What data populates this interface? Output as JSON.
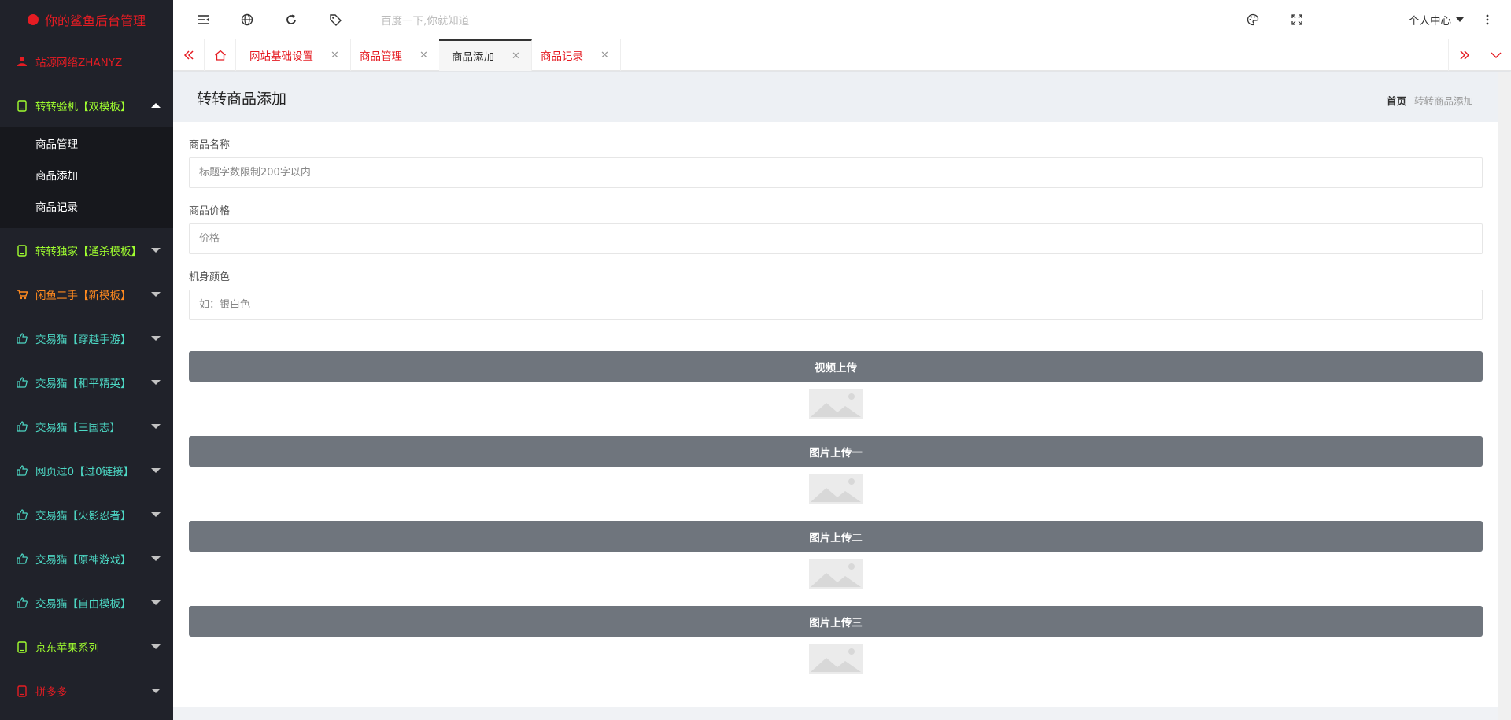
{
  "app": {
    "title": "你的鲨鱼后台管理",
    "colors": {
      "brand": "#e51c23",
      "sidebar_bg": "#20222a",
      "submenu_bg": "#17181d",
      "upload_btn": "#6f757d"
    }
  },
  "sidebar": {
    "items": [
      {
        "label": "站源网络ZHANYZ",
        "icon": "user-icon",
        "color": "#e51c23"
      },
      {
        "label": "转转验机【双模板】",
        "icon": "phone-icon",
        "color": "#a0ff2f",
        "expanded": true,
        "children": [
          {
            "label": "商品管理"
          },
          {
            "label": "商品添加"
          },
          {
            "label": "商品记录"
          }
        ]
      },
      {
        "label": "转转独家【通杀模板】",
        "icon": "phone-icon",
        "color": "#a0ff2f"
      },
      {
        "label": "闲鱼二手【新模板】",
        "icon": "cart-icon",
        "color": "#ff8a1f"
      },
      {
        "label": "交易猫【穿越手游】",
        "icon": "thumbs-up-icon",
        "color": "#4dd9c5"
      },
      {
        "label": "交易猫【和平精英】",
        "icon": "thumbs-up-icon",
        "color": "#4dd9c5"
      },
      {
        "label": "交易猫【三国志】",
        "icon": "thumbs-up-icon",
        "color": "#4dd9c5"
      },
      {
        "label": "网页过0【过0链接】",
        "icon": "thumbs-up-icon",
        "color": "#4dd9c5"
      },
      {
        "label": "交易猫【火影忍者】",
        "icon": "thumbs-up-icon",
        "color": "#4dd9c5"
      },
      {
        "label": "交易猫【原神游戏】",
        "icon": "thumbs-up-icon",
        "color": "#4dd9c5"
      },
      {
        "label": "交易猫【自由模板】",
        "icon": "thumbs-up-icon",
        "color": "#4dd9c5"
      },
      {
        "label": "京东苹果系列",
        "icon": "phone-icon",
        "color": "#a0ff2f"
      },
      {
        "label": "拼多多",
        "icon": "phone-icon",
        "color": "#e51c23"
      }
    ]
  },
  "header": {
    "search_placeholder": "百度一下,你就知道",
    "user_center": "个人中心",
    "icons": [
      "menu-toggle-icon",
      "globe-icon",
      "refresh-icon",
      "tag-icon",
      "theme-icon",
      "fullscreen-icon",
      "more-icon"
    ]
  },
  "tabs": {
    "items": [
      {
        "label": "网站基础设置",
        "active": false
      },
      {
        "label": "商品管理",
        "active": false
      },
      {
        "label": "商品添加",
        "active": true
      },
      {
        "label": "商品记录",
        "active": false
      }
    ]
  },
  "page": {
    "title": "转转商品添加",
    "breadcrumb_home": "首页",
    "breadcrumb_current": "转转商品添加"
  },
  "form": {
    "name_label": "商品名称",
    "name_placeholder": "标题字数限制200字以内",
    "price_label": "商品价格",
    "price_placeholder": "价格",
    "color_label": "机身颜色",
    "color_placeholder": "如：银白色",
    "uploads": [
      {
        "label": "视频上传"
      },
      {
        "label": "图片上传一"
      },
      {
        "label": "图片上传二"
      },
      {
        "label": "图片上传三"
      }
    ]
  }
}
